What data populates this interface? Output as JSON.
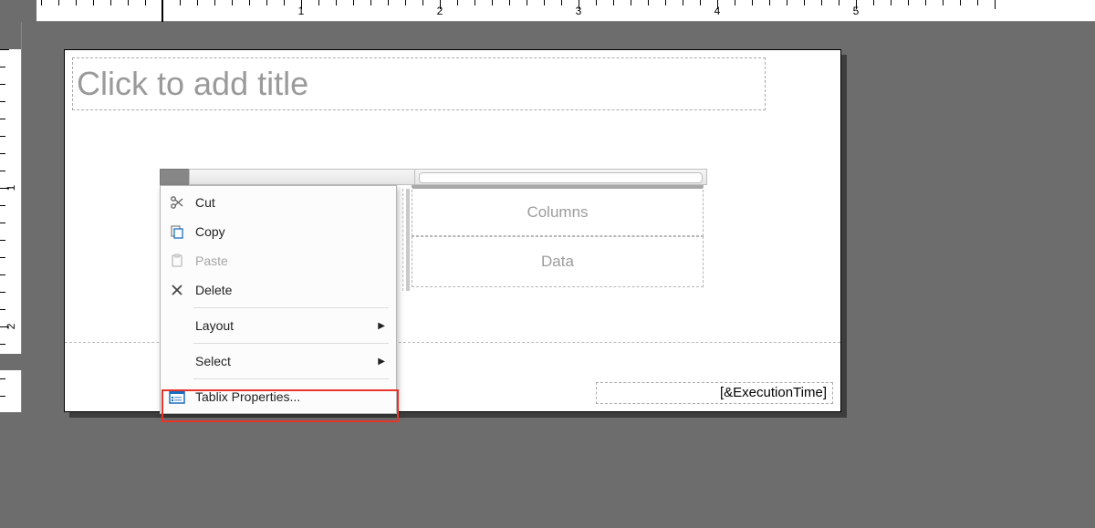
{
  "ruler": {
    "h_numbers": [
      "1",
      "2",
      "3",
      "4",
      "5"
    ],
    "v_numbers": [
      "1",
      "2"
    ]
  },
  "report": {
    "title_placeholder": "Click to add title",
    "footer_expression": "[&ExecutionTime]"
  },
  "tablix": {
    "column_group_label": "Columns",
    "data_label": "Data"
  },
  "context_menu": {
    "items": [
      {
        "id": "cut",
        "label": "Cut",
        "icon": "scissors",
        "enabled": true
      },
      {
        "id": "copy",
        "label": "Copy",
        "icon": "copy",
        "enabled": true
      },
      {
        "id": "paste",
        "label": "Paste",
        "icon": "clipboard",
        "enabled": false
      },
      {
        "id": "delete",
        "label": "Delete",
        "icon": "x",
        "enabled": true
      },
      {
        "sep": true
      },
      {
        "id": "layout",
        "label": "Layout",
        "submenu": true,
        "enabled": true
      },
      {
        "sep": true
      },
      {
        "id": "select",
        "label": "Select",
        "submenu": true,
        "enabled": true
      },
      {
        "sep": true
      },
      {
        "id": "tablix-properties",
        "label": "Tablix Properties...",
        "icon": "properties",
        "enabled": true,
        "highlighted": true
      }
    ]
  }
}
